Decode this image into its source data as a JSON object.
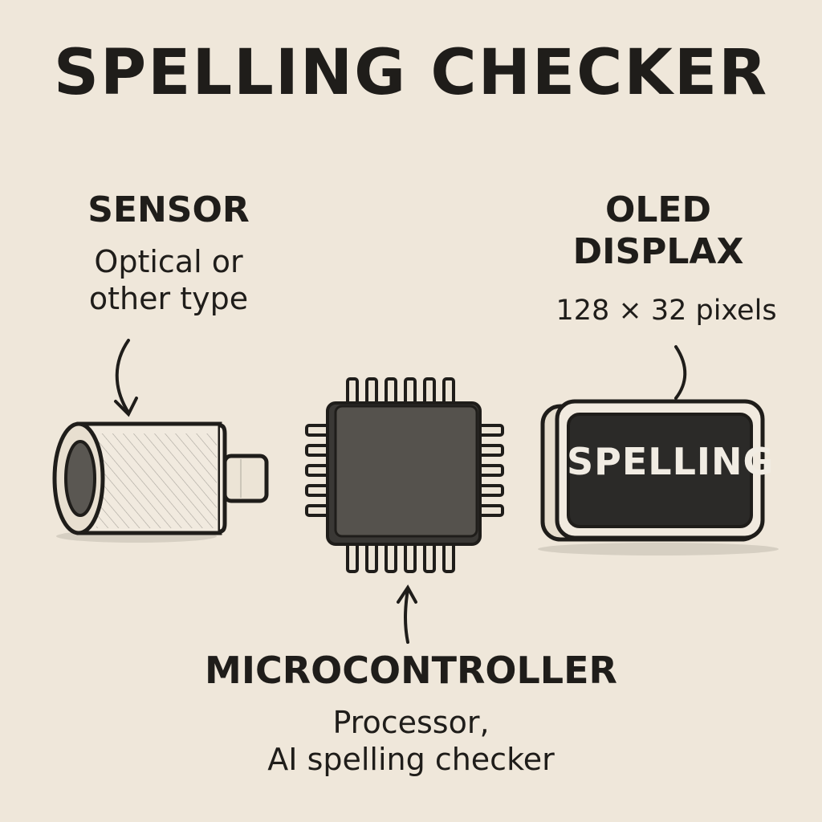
{
  "title": "SPELLING CHECKER",
  "sensor": {
    "heading": "SENSOR",
    "lines": [
      "Optical or",
      "other type"
    ]
  },
  "oled": {
    "heading_lines": [
      "OLED",
      "DISPLAX"
    ],
    "spec": "128 × 32 pixels",
    "screen_text": "SPELLING"
  },
  "microcontroller": {
    "heading": "MICROCONTROLLER",
    "lines": [
      "Processor,",
      "AI spelling checker"
    ]
  },
  "colors": {
    "background": "#efe7da",
    "ink": "#1f1d1a",
    "chip": "#4a4844",
    "screen": "#2b2a28"
  }
}
